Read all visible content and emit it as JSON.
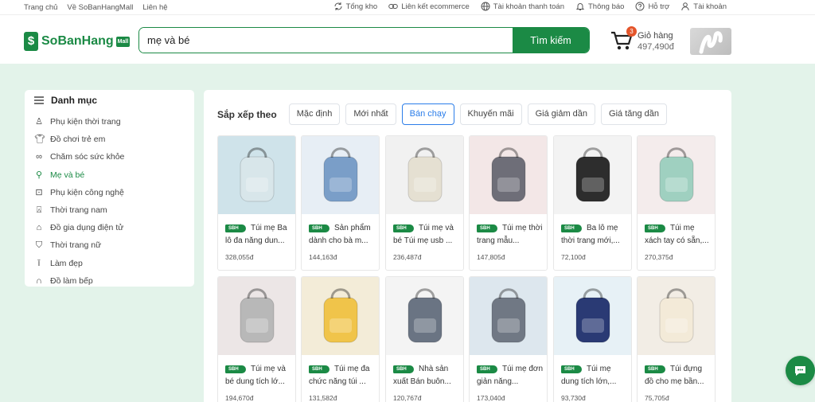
{
  "topbar": {
    "left_links": [
      "Trang chủ",
      "Về SoBanHangMall",
      "Liên hệ"
    ],
    "right_links": [
      {
        "label": "Tổng kho",
        "icon": "refresh-icon"
      },
      {
        "label": "Liên kết ecommerce",
        "icon": "link-icon"
      },
      {
        "label": "Tài khoản thanh toán",
        "icon": "globe-icon"
      },
      {
        "label": "Thông báo",
        "icon": "bell-icon"
      },
      {
        "label": "Hỗ trợ",
        "icon": "help-icon"
      },
      {
        "label": "Tài khoản",
        "icon": "user-icon"
      }
    ]
  },
  "header": {
    "logo_text": "SoBanHang",
    "logo_badge": "Mall",
    "search_value": "mẹ và bé",
    "search_button": "Tìm kiếm",
    "cart_count": "3",
    "cart_label": "Giỏ hàng",
    "cart_amount": "497,490đ"
  },
  "sidebar": {
    "title": "Danh mục",
    "items": [
      {
        "label": "Phụ kiện thời trang",
        "icon": "accessory-icon"
      },
      {
        "label": "Đồ chơi trẻ em",
        "icon": "shirt-icon"
      },
      {
        "label": "Chăm sóc sức khỏe",
        "icon": "glasses-icon"
      },
      {
        "label": "Mẹ và bé",
        "icon": "pacifier-icon",
        "active": true
      },
      {
        "label": "Phụ kiện công nghệ",
        "icon": "camera-icon"
      },
      {
        "label": "Thời trang nam",
        "icon": "jacket-icon"
      },
      {
        "label": "Đồ gia dụng điện tử",
        "icon": "appliance-icon"
      },
      {
        "label": "Thời trang nữ",
        "icon": "dress-icon"
      },
      {
        "label": "Làm đẹp",
        "icon": "brush-icon"
      },
      {
        "label": "Đồ làm bếp",
        "icon": "headphones-icon"
      }
    ]
  },
  "sort": {
    "label": "Sắp xếp theo",
    "options": [
      "Mặc định",
      "Mới nhất",
      "Bán chạy",
      "Khuyến mãi",
      "Giá giảm dần",
      "Giá tăng dần"
    ],
    "active_index": 2
  },
  "products": [
    {
      "tag": "SBH",
      "title": "Túi mẹ Ba lô đa năng dun...",
      "price": "328,055đ",
      "img_color": "#cfe3ea",
      "bag_color": "#d8e6ea"
    },
    {
      "tag": "SBH",
      "title": "Sản phẩm dành cho bà m...",
      "price": "144,163đ",
      "img_color": "#e7eef5",
      "bag_color": "#7a9ec8"
    },
    {
      "tag": "SBH",
      "title": "Túi mẹ và bé Túi mẹ usb ...",
      "price": "236,487đ",
      "img_color": "#f1f1f1",
      "bag_color": "#e5e0d2"
    },
    {
      "tag": "SBH",
      "title": "Túi mẹ thời trang mẫu...",
      "price": "147,805đ",
      "img_color": "#f3e7e7",
      "bag_color": "#6e6e78"
    },
    {
      "tag": "SBH",
      "title": "Ba lô mẹ thời trang mới,...",
      "price": "72,100đ",
      "img_color": "#f3f3f3",
      "bag_color": "#2d2d2d"
    },
    {
      "tag": "SBH",
      "title": "Túi mẹ xách tay có sẵn,...",
      "price": "270,375đ",
      "img_color": "#f4ecec",
      "bag_color": "#9fd0c0"
    },
    {
      "tag": "SBH",
      "title": "Túi mẹ và bé dung tích lớ...",
      "price": "194,670đ",
      "img_color": "#ece6e6",
      "bag_color": "#b8b8b8"
    },
    {
      "tag": "SBH",
      "title": "Túi mẹ đa chức năng túi ...",
      "price": "131,582đ",
      "img_color": "#f3ecd8",
      "bag_color": "#f0c44a"
    },
    {
      "tag": "SBH",
      "title": "Nhà sản xuất Bán buôn...",
      "price": "120,767đ",
      "img_color": "#f4f4f4",
      "bag_color": "#6a7483"
    },
    {
      "tag": "SBH",
      "title": "Túi mẹ đơn giản năng...",
      "price": "173,040đ",
      "img_color": "#dde7ee",
      "bag_color": "#707884"
    },
    {
      "tag": "SBH",
      "title": "Túi mẹ dung tích lớn,...",
      "price": "93,730đ",
      "img_color": "#e7f1f6",
      "bag_color": "#2a3a74"
    },
    {
      "tag": "SBH",
      "title": "Túi đựng đồ cho mẹ bần...",
      "price": "75,705đ",
      "img_color": "#f2ede5",
      "bag_color": "#f3ead8"
    }
  ],
  "chat_icon": "chat-icon",
  "colors": {
    "brand": "#1b8a45",
    "accent_blue": "#2b7de9",
    "badge": "#e4552b",
    "background": "#e3f3ea"
  }
}
